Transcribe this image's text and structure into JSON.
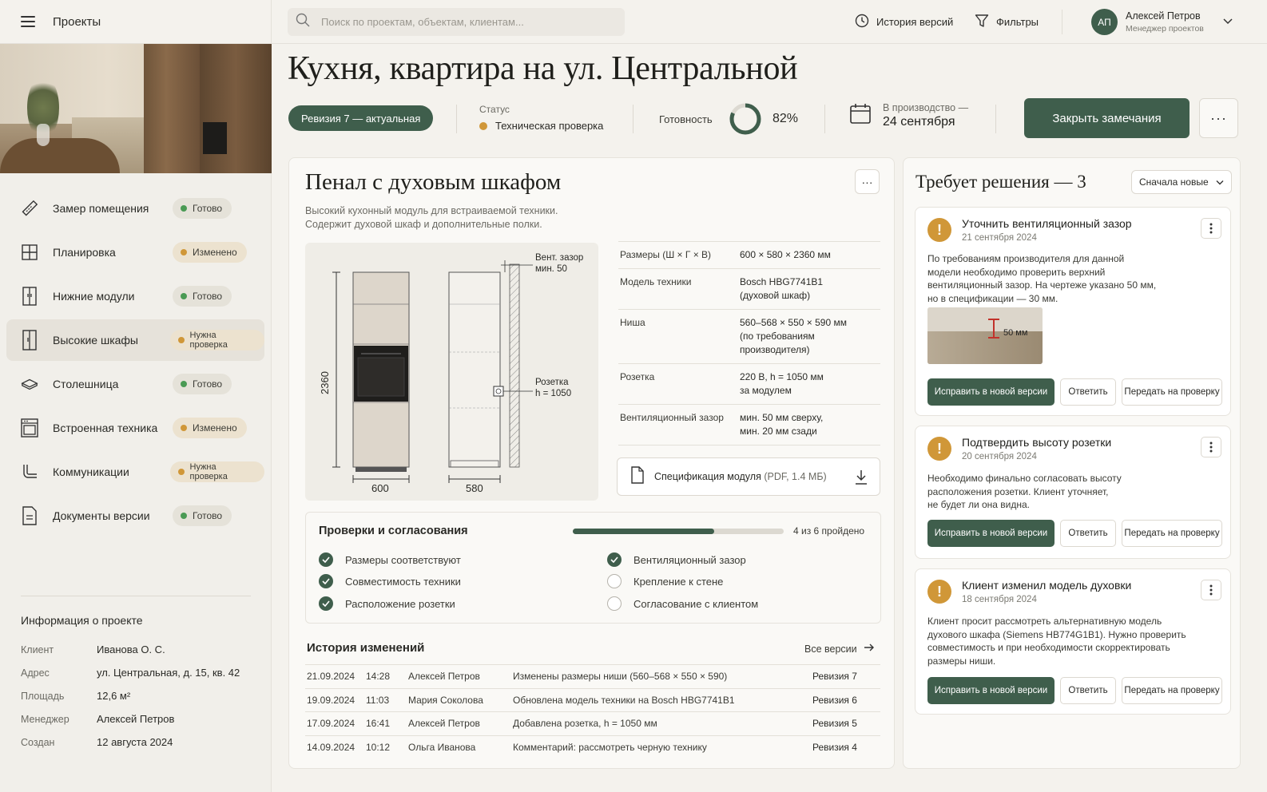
{
  "sidebar": {
    "title": "Проекты",
    "items": [
      {
        "label": "Замер помещения",
        "status": "Готово"
      },
      {
        "label": "Планировка",
        "status": "Изменено"
      },
      {
        "label": "Нижние модули",
        "status": "Готово"
      },
      {
        "label": "Высокие шкафы",
        "status": "Нужна проверка"
      },
      {
        "label": "Столешница",
        "status": "Готово"
      },
      {
        "label": "Встроенная техника",
        "status": "Изменено"
      },
      {
        "label": "Коммуникации",
        "status": "Нужна проверка"
      },
      {
        "label": "Документы версии",
        "status": "Готово"
      }
    ],
    "info": {
      "title": "Информация о проекте",
      "rows": [
        {
          "k": "Клиент",
          "v": "Иванова О. С."
        },
        {
          "k": "Адрес",
          "v": "ул. Центральная, д. 15, кв. 42"
        },
        {
          "k": "Площадь",
          "v": "12,6 м²"
        },
        {
          "k": "Менеджер",
          "v": "Алексей Петров"
        },
        {
          "k": "Создан",
          "v": "12 августа 2024"
        }
      ]
    }
  },
  "topbar": {
    "search_placeholder": "Поиск по проектам, объектам, клиентам...",
    "history": "История версий",
    "filters": "Фильтры",
    "avatar": "АП",
    "user_name": "Алексей Петров",
    "user_role": "Менеджер проектов"
  },
  "header": {
    "title": "Кухня, квартира на ул. Центральной",
    "revision": "Ревизия 7 — актуальная",
    "status_label": "Статус",
    "status_value": "Техническая проверка",
    "ready_label": "Готовность",
    "ready_value": "82%",
    "ready_fraction": 0.82,
    "due_label": "В производство —",
    "due_value": "24 сентября",
    "close_button": "Закрыть замечания",
    "more": "···"
  },
  "module": {
    "title": "Пенал с духовым шкафом",
    "desc1": "Высокий кухонный модуль для встраиваемой техники.",
    "desc2": "Содержит духовой шкаф и дополнительные полки.",
    "drawing": {
      "height": "2360",
      "width": "600",
      "depth": "580",
      "vent1": "Вент. зазор",
      "vent2": "мин. 50",
      "socket1": "Розетка",
      "socket2": "h = 1050"
    },
    "spec": [
      {
        "k": "Размеры (Ш × Г × В)",
        "v1": "600 × 580 × 2360 мм",
        "v2": "",
        "v3": ""
      },
      {
        "k": "Модель техники",
        "v1": "Bosch HBG7741B1",
        "v2": "(духовой шкаф)",
        "v3": ""
      },
      {
        "k": "Ниша",
        "v1": "560–568 × 550 × 590 мм",
        "v2": "(по требованиям",
        "v3": "производителя)"
      },
      {
        "k": "Розетка",
        "v1": "220 В, h = 1050 мм",
        "v2": "за модулем",
        "v3": ""
      },
      {
        "k": "Вентиляционный зазор",
        "v1": "мин. 50 мм сверху,",
        "v2": "мин. 20 мм сзади",
        "v3": ""
      }
    ],
    "file_name": "Спецификация модуля",
    "file_meta": "(PDF, 1.4 МБ)"
  },
  "checks": {
    "title": "Проверки и согласования",
    "progress_text": "4 из 6 пройдено",
    "progress_fraction": 0.67,
    "items": [
      {
        "label": "Размеры соответствуют",
        "done": true
      },
      {
        "label": "Совместимость техники",
        "done": true
      },
      {
        "label": "Расположение розетки",
        "done": true
      },
      {
        "label": "Вентиляционный зазор",
        "done": true
      },
      {
        "label": "Крепление к стене",
        "done": false
      },
      {
        "label": "Согласование с клиентом",
        "done": false
      }
    ]
  },
  "history": {
    "title": "История изменений",
    "all_versions": "Все версии",
    "rows": [
      {
        "date": "21.09.2024",
        "time": "14:28",
        "user": "Алексей Петров",
        "change": "Изменены размеры ниши (560–568 × 550 × 590)",
        "rev": "Ревизия 7"
      },
      {
        "date": "19.09.2024",
        "time": "11:03",
        "user": "Мария Соколова",
        "change": "Обновлена модель техники на Bosch HBG7741B1",
        "rev": "Ревизия 6"
      },
      {
        "date": "17.09.2024",
        "time": "16:41",
        "user": "Алексей Петров",
        "change": "Добавлена розетка, h = 1050 мм",
        "rev": "Ревизия 5"
      },
      {
        "date": "14.09.2024",
        "time": "10:12",
        "user": "Ольга Иванова",
        "change": "Комментарий: рассмотреть черную технику",
        "rev": "Ревизия 4"
      }
    ]
  },
  "panel": {
    "title": "Требует решения — 3",
    "sort": "Сначала новые",
    "issues": [
      {
        "title": "Уточнить вентиляционный зазор",
        "date": "21 сентября 2024",
        "lines": [
          "По требованиям производителя для данной",
          "модели необходимо проверить верхний",
          "вентиляционный зазор. На чертеже указано 50 мм,",
          "но в спецификации — 30 мм."
        ],
        "photo_label": "50 мм"
      },
      {
        "title": "Подтвердить высоту розетки",
        "date": "20 сентября 2024",
        "lines": [
          "Необходимо финально согласовать высоту",
          "расположения розетки. Клиент уточняет,",
          "не будет ли она видна."
        ]
      },
      {
        "title": "Клиент изменил модель духовки",
        "date": "18 сентября 2024",
        "lines": [
          "Клиент просит рассмотреть альтернативную модель",
          "духового шкафа (Siemens HB774G1B1). Нужно проверить",
          "совместимость и при необходимости скорректировать",
          "размеры ниши."
        ]
      }
    ],
    "btn_fix": "Исправить в новой версии",
    "btn_reply": "Ответить",
    "btn_review": "Передать на проверку"
  },
  "colors": {
    "accent": "#3f5e4c",
    "ok": "#4a9a54",
    "warn": "#d09738"
  }
}
